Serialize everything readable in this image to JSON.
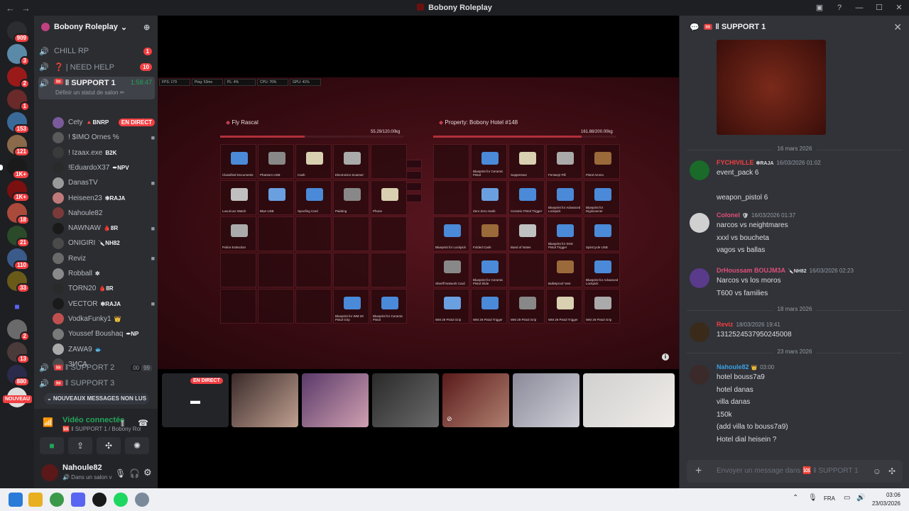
{
  "window": {
    "title": "Bobony Roleplay"
  },
  "servers": {
    "badges": [
      "909",
      "3",
      "2",
      "1",
      "153",
      "121",
      "1K+",
      "1K+",
      "18",
      "21",
      "110",
      "33",
      "2",
      "13",
      "880"
    ],
    "new_label": "NOUVEAU"
  },
  "sidebar": {
    "guild_name": "Bobony Roleplay",
    "channels": [
      {
        "name": "CHILL RP",
        "count": "1"
      },
      {
        "name": "❓ | NEED HELP",
        "count": "10"
      }
    ],
    "active_channel": {
      "tag": "🆘",
      "name": "‖ SUPPORT 1",
      "timer": "1:58:47",
      "status": "Définir un statut de salon ✏"
    },
    "users": [
      {
        "name": "Cety",
        "badge": "🔺BNRP",
        "live": "EN DIRECT"
      },
      {
        "name": "! $IMO Ornes %",
        "badge": ""
      },
      {
        "name": "! Izaax.exe",
        "badge": "B2K"
      },
      {
        "name": "!EduardoX37",
        "badge": "✒NPV"
      },
      {
        "name": "DanasTV",
        "badge": ""
      },
      {
        "name": "Heiseen23",
        "badge": "❇RAJA"
      },
      {
        "name": "Nahoule82",
        "badge": ""
      },
      {
        "name": "NAWNAW",
        "badge": "🩸8R"
      },
      {
        "name": "ONIGIRI",
        "badge": "🔪NH82"
      },
      {
        "name": "Reviz",
        "badge": ""
      },
      {
        "name": "Robball",
        "badge": "✲"
      },
      {
        "name": "TORN20",
        "badge": "🩸8R"
      },
      {
        "name": "VECTOR",
        "badge": "❇RAJA"
      },
      {
        "name": "VodkaFunky1",
        "badge": "👑"
      },
      {
        "name": "Youssef Boushaq",
        "badge": "✒NP"
      },
      {
        "name": "ZAWA9",
        "badge": "🐟"
      },
      {
        "name": "ЗИСА",
        "badge": ""
      }
    ],
    "support2": {
      "tag": "🆘",
      "name": "‖ SUPPORT 2",
      "c1": "00",
      "c2": "99"
    },
    "support3": {
      "tag": "🆘",
      "name": "‖ SUPPORT 3"
    },
    "new_messages": "⌄ NOUVEAUX MESSAGES NON LUS",
    "voice": {
      "status": "Vidéo connectée",
      "location": "🆘 ‖ SUPPORT 1 / Bobony Role...",
      "buttons": [
        "camera-icon",
        "screen-share-icon",
        "activities-icon",
        "soundboard-icon"
      ]
    },
    "me": {
      "name": "Nahoule82",
      "status": "🔊 Dans un salon v"
    }
  },
  "game": {
    "perf": [
      "FPS: 179",
      "Ping: 53ms",
      "PL: 4%",
      "CPU: 76%",
      "GPU: 41%"
    ],
    "left_inventory": {
      "title": "Fly Rascal",
      "weight": "55.29/120.00kg",
      "fill": 0.46,
      "items": [
        "Classified Documents",
        "Phantom USB",
        "Cash",
        "Electronics Scanner",
        "",
        "Luxurious Watch",
        "Blue USB",
        "Spoofing Card",
        "Painting",
        "Phone",
        "Police Extinction",
        "",
        "",
        "",
        "",
        "",
        "",
        "",
        "",
        "",
        "",
        "",
        "",
        "Blueprint for WM 29 Pistol Grip",
        "Blueprint for Ceramic Pistol"
      ]
    },
    "right_inventory": {
      "title": "Property: Bobony Hotel #148",
      "weight": "161.88/200.00kg",
      "fill": 0.81,
      "items": [
        "",
        "Blueprint for Ceramic Pistol",
        "Suppressor",
        "Fentanyl Pill",
        "Pistol Ammo",
        "",
        "Zero Zero Hash",
        "Ceramic Pistol Trigger",
        "Blueprint for Advanced Lockpick",
        "Blueprint for Digiscanner",
        "Blueprint for Lockpick",
        "Folded Cash",
        "Band of Notes",
        "Blueprint for SNS Pistol Trigger",
        "SpinCycle USB",
        "Sheriff Network Card",
        "Blueprint for Ceramic Pistol Slide",
        "",
        "Bulletproof Vest",
        "Blueprint for Advanced Lockpick",
        "WM 29 Pistol Grip",
        "WM 29 Pistol Trigger",
        "WM 29 Pistol Grip",
        "WM 29 Pistol Trigger",
        "WM 29 Pistol Grip"
      ]
    }
  },
  "tiles": {
    "live_label": "EN DIRECT"
  },
  "panel": {
    "channel_tag": "🆘",
    "channel_name": "‖ SUPPORT 1",
    "dates": [
      "16 mars 2026",
      "18 mars 2026",
      "23 mars 2026"
    ],
    "messages": [
      {
        "author": "FYCHIVILLE",
        "badge": "❇RAJA",
        "time": "16/03/2026 01:02",
        "lines": [
          "event_pack 6",
          "",
          "weapon_pistol 6"
        ],
        "color": "#f23f42"
      },
      {
        "author": "Colonel",
        "badge": "🛡",
        "time": "16/03/2026 01:37",
        "lines": [
          "narcos vs neightmares",
          "xxxl vs boucheta",
          "vagos vs ballas"
        ],
        "color": "#e0507a"
      },
      {
        "author": "DrHoussam BOUJM3A",
        "badge": "🔪NH82",
        "time": "16/03/2026 02:23",
        "lines": [
          "Narcos vs los moros",
          "T600 vs families"
        ],
        "color": "#e0507a"
      },
      {
        "author": "Reviz",
        "badge": "",
        "time": "18/03/2026 19:41",
        "lines": [
          "1312524537950245008"
        ],
        "color": "#f23f42"
      },
      {
        "author": "Nahoule82",
        "badge": "👑",
        "time": "03:00",
        "lines": [
          "hotel bouss7a9",
          "hotel danas",
          "villa danas",
          "150k",
          "(add villa to bouss7a9)",
          "Hotel dial heisein ?"
        ],
        "color": "#3ba0e6"
      }
    ],
    "composer_placeholder": "Envoyer un message dans 🆘 ‖ SUPPORT 1"
  },
  "taskbar": {
    "lang": "FRA",
    "time": "03:06",
    "date": "23/03/2026"
  }
}
